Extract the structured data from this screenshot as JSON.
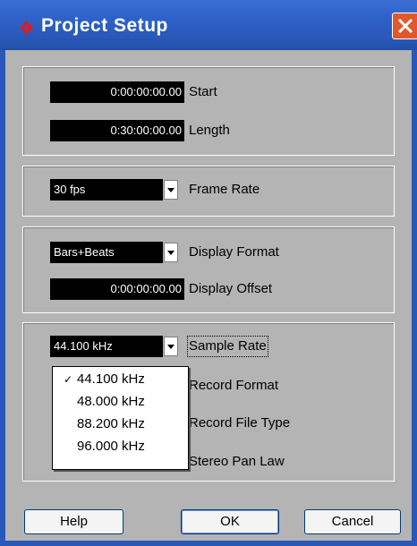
{
  "window": {
    "title": "Project Setup",
    "icon": "cubase-red-diamond-icon",
    "close_icon": "close-x-icon"
  },
  "time": {
    "start_value": "0:00:00:00.00",
    "start_label": "Start",
    "length_value": "0:30:00:00.00",
    "length_label": "Length"
  },
  "frame_rate": {
    "value": "30 fps",
    "label": "Frame Rate"
  },
  "display": {
    "format_value": "Bars+Beats",
    "format_label": "Display Format",
    "offset_value": "0:00:00:00.00",
    "offset_label": "Display Offset"
  },
  "audio": {
    "sample_rate_value": "44.100 kHz",
    "sample_rate_label": "Sample Rate",
    "record_format_label": "Record Format",
    "record_file_type_label": "Record File Type",
    "stereo_pan_law_label": "Stereo Pan Law"
  },
  "sample_rate_menu": {
    "check": "✓",
    "options": [
      "44.100 kHz",
      "48.000 kHz",
      "88.200 kHz",
      "96.000 kHz"
    ],
    "selected": "44.100 kHz"
  },
  "buttons": {
    "help": "Help",
    "ok": "OK",
    "cancel": "Cancel"
  },
  "colors": {
    "titlebar": "#2f62c8",
    "panel": "#b4b4b4",
    "field_bg": "#000000",
    "close": "#e0582b"
  }
}
